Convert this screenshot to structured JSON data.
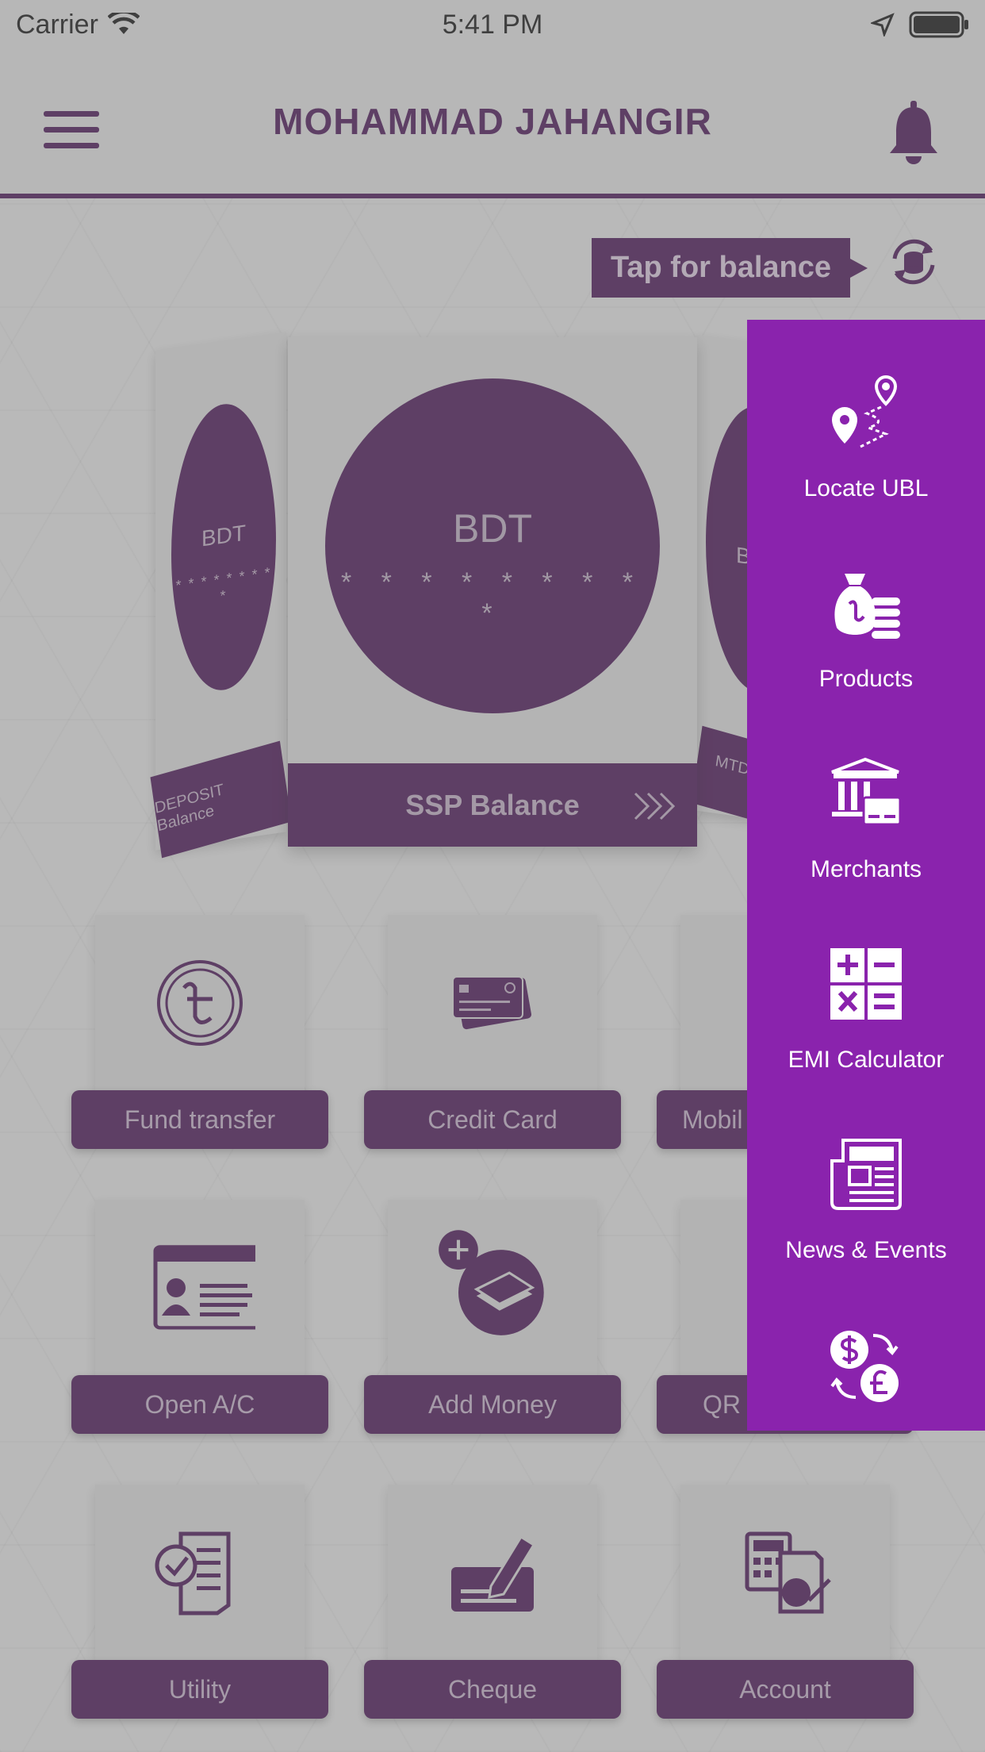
{
  "status_bar": {
    "carrier": "Carrier",
    "time": "5:41 PM"
  },
  "header": {
    "user_name": "MOHAMMAD JAHANGIR"
  },
  "balance": {
    "tap_label": "Tap for balance",
    "cards": [
      {
        "label": "DEPOSIT Balance",
        "currency": "BDT",
        "masked": "* * * * * * * * *"
      },
      {
        "label": "SSP Balance",
        "currency": "BDT",
        "masked": "* * * * * * * * *"
      },
      {
        "label": "MTDR B",
        "currency": "B",
        "masked": "* * *"
      }
    ]
  },
  "tiles": [
    {
      "label": "Fund transfer",
      "icon": "taka-coin-icon"
    },
    {
      "label": "Credit Card",
      "icon": "credit-card-icon"
    },
    {
      "label": "Mobil",
      "icon": "mobile-icon"
    },
    {
      "label": "Open A/C",
      "icon": "id-card-icon"
    },
    {
      "label": "Add Money",
      "icon": "add-money-icon"
    },
    {
      "label": "QR",
      "icon": "qr-icon"
    },
    {
      "label": "Utility",
      "icon": "utility-bill-icon"
    },
    {
      "label": "Cheque",
      "icon": "cheque-icon"
    },
    {
      "label": "Account",
      "icon": "account-statement-icon"
    }
  ],
  "side_menu": {
    "items": [
      {
        "label": "Locate UBL",
        "icon": "location-route-icon"
      },
      {
        "label": "Products",
        "icon": "money-bag-icon"
      },
      {
        "label": "Merchants",
        "icon": "bank-building-icon"
      },
      {
        "label": "EMI Calculator",
        "icon": "calculator-icon"
      },
      {
        "label": "News & Events",
        "icon": "newspaper-icon"
      },
      {
        "label": "",
        "icon": "currency-exchange-icon"
      }
    ],
    "background": "#8a23ad"
  },
  "colors": {
    "primary": "#4a1156",
    "side_menu": "#8a23ad"
  }
}
